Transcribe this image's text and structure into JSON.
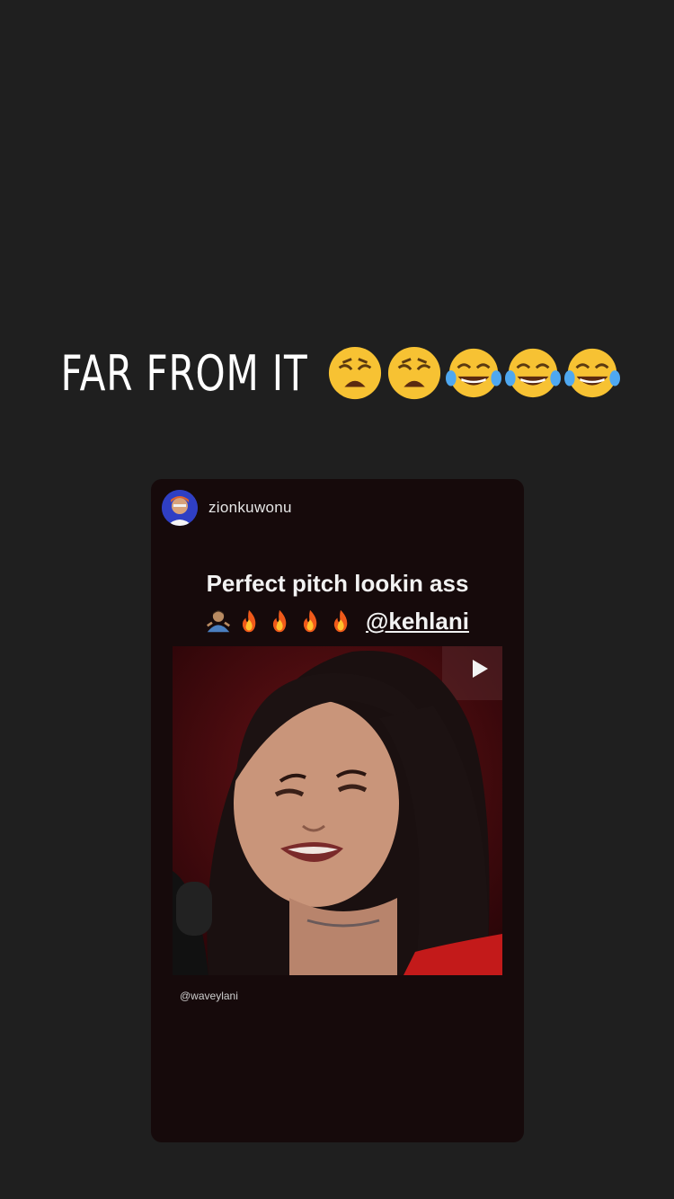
{
  "story": {
    "caption": "FAR FROM IT",
    "caption_emojis": [
      "weary-face-icon",
      "weary-face-icon",
      "tears-of-joy-icon",
      "tears-of-joy-icon",
      "tears-of-joy-icon"
    ]
  },
  "shared_post": {
    "username": "zionkuwonu",
    "text_line1": "Perfect pitch lookin ass",
    "text_line2_emojis": [
      "man-shrugging-icon",
      "fire-icon",
      "fire-icon",
      "fire-icon",
      "fire-icon"
    ],
    "mention": "@kehlani",
    "video_credit": "@waveylani"
  },
  "colors": {
    "background": "#1f1f1f",
    "card": "#160a0b",
    "video_bg": "#4a0c10"
  }
}
